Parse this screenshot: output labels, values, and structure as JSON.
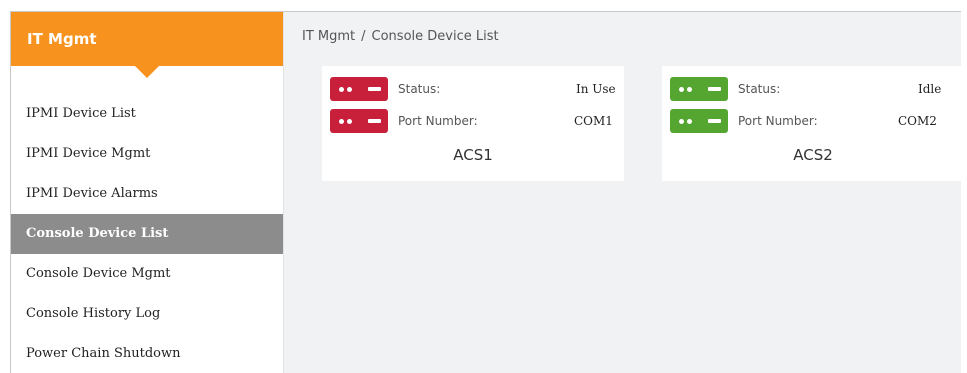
{
  "sidebar": {
    "title": "IT Mgmt",
    "accent_color": "#f7921e",
    "items": [
      {
        "label": "IPMI Device List",
        "active": false
      },
      {
        "label": "IPMI Device Mgmt",
        "active": false
      },
      {
        "label": "IPMI Device Alarms",
        "active": false
      },
      {
        "label": "Console Device List",
        "active": true
      },
      {
        "label": "Console Device Mgmt",
        "active": false
      },
      {
        "label": "Console History Log",
        "active": false
      },
      {
        "label": "Power Chain Shutdown",
        "active": false
      }
    ]
  },
  "breadcrumb": {
    "root": "IT Mgmt",
    "separator": "/",
    "current": "Console Device List"
  },
  "devices": [
    {
      "name": "ACS1",
      "status_label": "Status:",
      "status_value": "In Use",
      "port_label": "Port Number:",
      "port_value": "COM1",
      "icon": "server-icon",
      "color": "#c8203a"
    },
    {
      "name": "ACS2",
      "status_label": "Status:",
      "status_value": "Idle",
      "port_label": "Port Number:",
      "port_value": "COM2",
      "icon": "server-icon",
      "color": "#55a630"
    }
  ]
}
